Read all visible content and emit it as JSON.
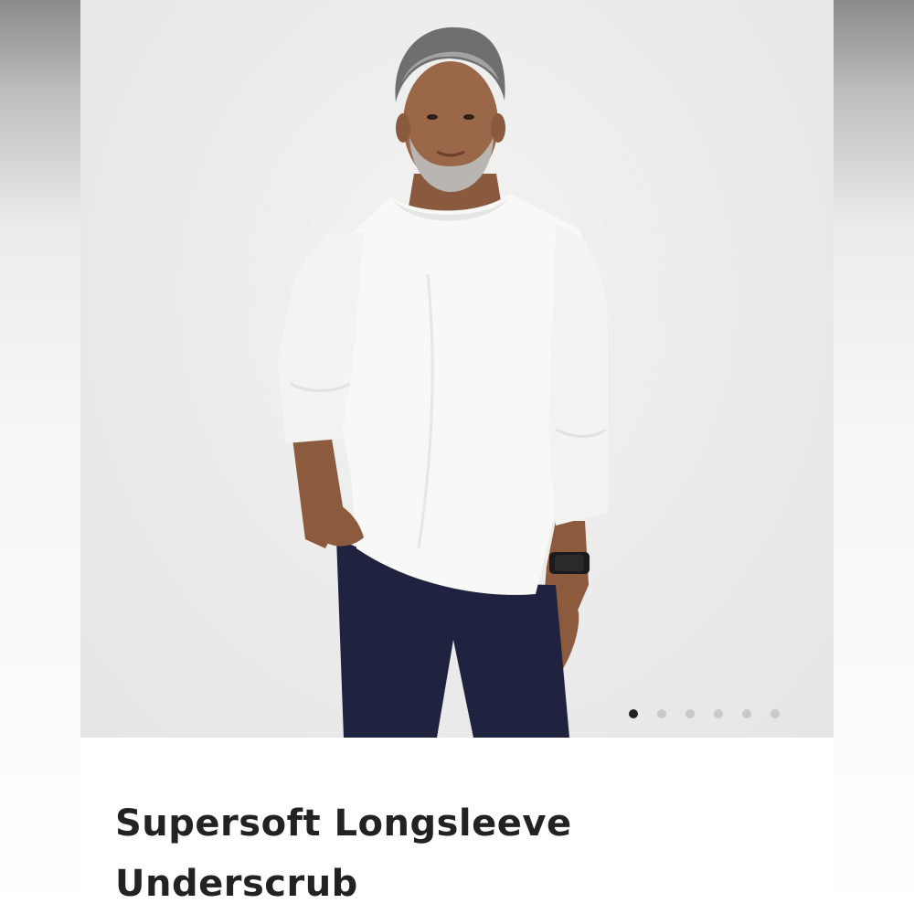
{
  "product": {
    "title_line1": "Supersoft Longsleeve",
    "title_line2": "Underscrub",
    "image": {
      "description_name": "product-model-photo"
    }
  },
  "carousel": {
    "total_slides": 6,
    "active_index": 0
  },
  "colors": {
    "shirt": "#f8f8f6",
    "pants": "#1f2340",
    "background": "#ececec",
    "active_dot": "#222222",
    "inactive_dot": "#c9c9c9"
  }
}
